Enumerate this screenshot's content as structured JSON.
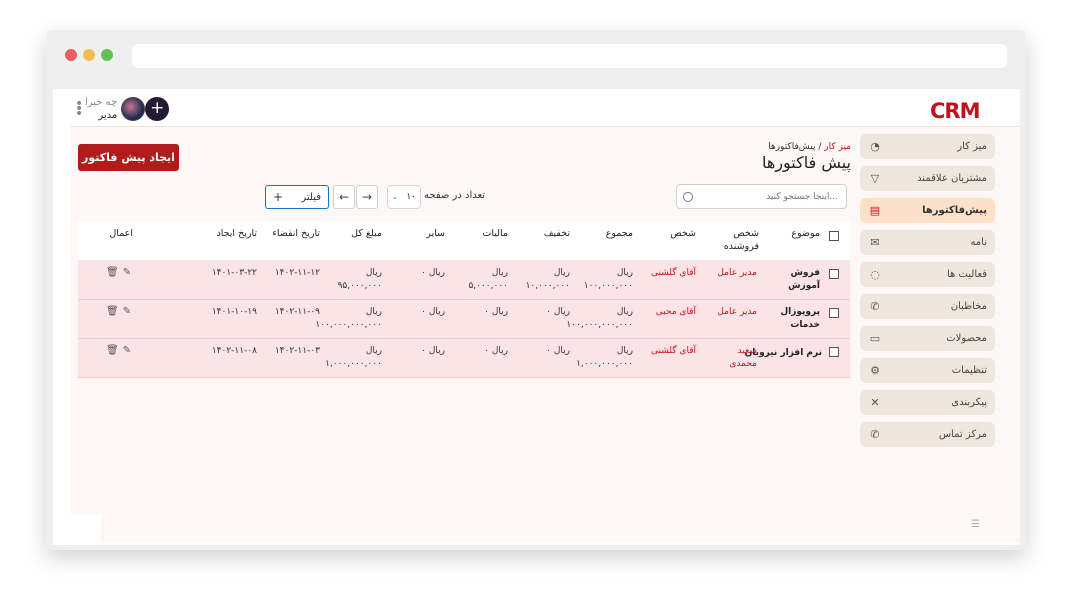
{
  "window": {
    "dot_colors": [
      "#ed5c5e",
      "#f5bd4f",
      "#5fc454"
    ]
  },
  "header": {
    "logo": "CRM",
    "user_hint": "چه خبرا",
    "user_role": "مدیر",
    "add_button": "+"
  },
  "sidebar": {
    "items": [
      {
        "label": "میز کار",
        "icon": "dashboard-icon"
      },
      {
        "label": "مشتریان علاقمند",
        "icon": "filter-icon"
      },
      {
        "label": "پیش‌فاکتورها",
        "icon": "document-icon",
        "active": true
      },
      {
        "label": "نامه",
        "icon": "mail-icon"
      },
      {
        "label": "فعالیت ها",
        "icon": "lightbulb-icon"
      },
      {
        "label": "مخاطبان",
        "icon": "phone-icon"
      },
      {
        "label": "محصولات",
        "icon": "box-icon"
      },
      {
        "label": "تنظیمات",
        "icon": "gear-icon"
      },
      {
        "label": "پیکربندی",
        "icon": "tools-icon"
      },
      {
        "label": "مرکز تماس",
        "icon": "phone-icon"
      }
    ]
  },
  "breadcrumb": {
    "home": "میز کار",
    "separator": "/",
    "current": "پیش‌فاکتورها"
  },
  "page_title": "پیش فاکتورها",
  "create_button": "ایجاد پیش فاکتور",
  "toolbar": {
    "search_placeholder": "...اینجا جستجو کنید",
    "per_page_label": "تعداد در صفحه",
    "per_page_value": "۱۰",
    "next_label": "→",
    "prev_label": "←",
    "filter_label": "فیلتر",
    "filter_plus": "+"
  },
  "table": {
    "headers": {
      "subject": "موضوع",
      "seller": "شخص فروشنده",
      "person": "شخص",
      "total": "مجموع",
      "discount": "تخفیف",
      "tax": "مالیات",
      "other": "سایر",
      "grand_total": "مبلغ کل",
      "expiry": "تاریخ انقضاء",
      "created": "تاریخ ایجاد",
      "actions": "اعمال"
    },
    "rows": [
      {
        "subject": "فروش آموزش",
        "seller": "مدیر عامل",
        "person": "آقای گلشنی",
        "total": "ریال ۱۰۰,۰۰۰,۰۰۰",
        "discount": "ریال ۱۰,۰۰۰,۰۰۰",
        "tax": "ریال ۵,۰۰۰,۰۰۰",
        "other": "ریال ۰",
        "grand_total": "ریال ۹۵,۰۰۰,۰۰۰",
        "expiry": "۱۴۰۲-۱۱-۱۲",
        "created": "۱۴۰۱-۰۳-۲۲"
      },
      {
        "subject": "پروپوزال خدمات",
        "seller": "مدیر عامل",
        "person": "آقای محبی",
        "total": "ریال ۱۰۰,۰۰۰,۰۰۰,۰۰۰",
        "discount": "ریال ۰",
        "tax": "ریال ۰",
        "other": "ریال ۰",
        "grand_total": "ریال ۱۰۰,۰۰۰,۰۰۰,۰۰۰",
        "expiry": "۱۴۰۲-۱۱-۰۹",
        "created": "۱۴۰۱-۱۰-۱۹"
      },
      {
        "subject": "نرم افزار نیروبان",
        "seller": "سعید محمدی",
        "person": "آقای گلشنی",
        "total": "ریال ۱,۰۰۰,۰۰۰,۰۰۰",
        "discount": "ریال ۰",
        "tax": "ریال ۰",
        "other": "ریال ۰",
        "grand_total": "ریال ۱,۰۰۰,۰۰۰,۰۰۰",
        "expiry": "۱۴۰۲-۱۱-۰۳",
        "created": "۱۴۰۲-۱۱-۰۸"
      }
    ]
  },
  "colors": {
    "brand": "#c1121f",
    "row_bg": "#fce4e6",
    "active_sidebar": "#fde0c8"
  }
}
